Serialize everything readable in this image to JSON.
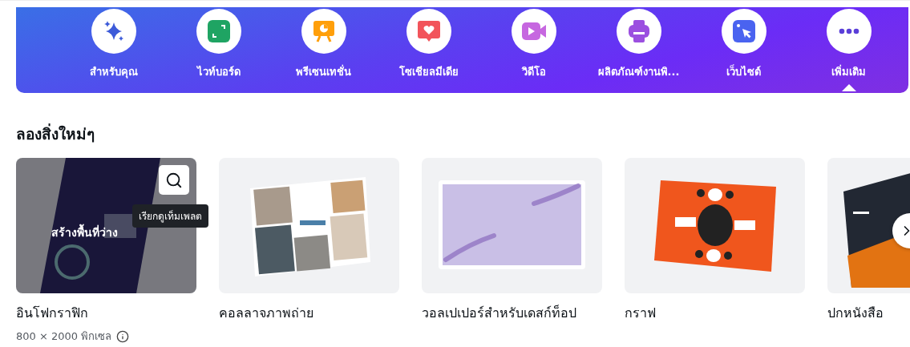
{
  "categories": [
    {
      "label": "สำหรับคุณ",
      "kind": "sparkle",
      "selected": false
    },
    {
      "label": "ไวท์บอร์ด",
      "kind": "whiteboard",
      "selected": false
    },
    {
      "label": "พรีเซนเทชั่น",
      "kind": "presentation",
      "selected": false
    },
    {
      "label": "โซเชียลมีเดีย",
      "kind": "social",
      "selected": false
    },
    {
      "label": "วิดีโอ",
      "kind": "video",
      "selected": false
    },
    {
      "label": "ผลิตภัณฑ์งานพิ...",
      "kind": "print",
      "selected": false
    },
    {
      "label": "เว็บไซต์",
      "kind": "website",
      "selected": false
    },
    {
      "label": "เพิ่มเติม",
      "kind": "more",
      "selected": true
    }
  ],
  "section_title": "ลองสิ่งใหม่ๆ",
  "templates": [
    {
      "title": "อินโฟกราฟิก",
      "kind": "infographic",
      "hovered": true,
      "overlay_text": "สร้างพื้นที่ว่าง",
      "tooltip": "เรียกดูเท็มเพลต",
      "subtitle": "800 × 2000 พิกเซล"
    },
    {
      "title": "คอลลาจภาพถ่าย",
      "kind": "collage",
      "hovered": false
    },
    {
      "title": "วอลเปเปอร์สำหรับเดสก์ท็อป",
      "kind": "wallpaper",
      "hovered": false
    },
    {
      "title": "กราฟ",
      "kind": "graph",
      "hovered": false
    },
    {
      "title": "ปกหนังสือ",
      "kind": "book",
      "hovered": false
    }
  ]
}
